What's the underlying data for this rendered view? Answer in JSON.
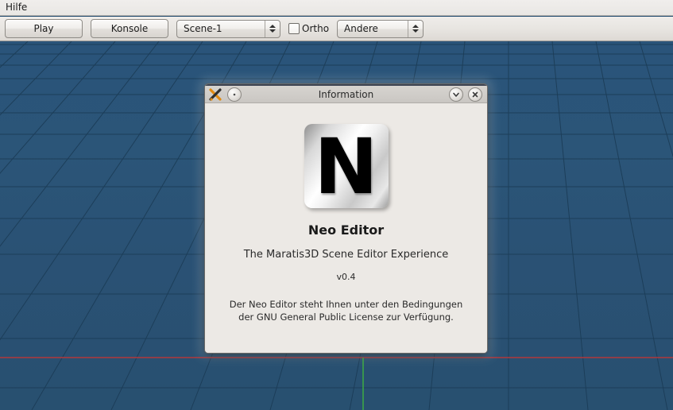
{
  "menubar": {
    "items": [
      {
        "label": "Hilfe",
        "name": "menu-item-hilfe"
      }
    ]
  },
  "toolbar": {
    "play_label": "Play",
    "console_label": "Konsole",
    "scene_combo": {
      "value": "Scene-1",
      "icon": "spinner-arrows-icon"
    },
    "ortho_checkbox": {
      "label": "Ortho",
      "checked": false
    },
    "other_combo": {
      "value": "Andere",
      "icon": "spinner-arrows-icon"
    }
  },
  "viewport": {
    "background_color": "#2a5375",
    "grid_line_color": "#1b3b56",
    "x_axis_color": "#b1383c",
    "z_axis_color": "#3fb23f"
  },
  "dialog": {
    "title": "Information",
    "app_icon": "maratis-app-icon",
    "menu_button_icon": "window-menu-icon",
    "shade_button_icon": "chevron-down-icon",
    "close_button_icon": "close-icon",
    "logo": {
      "letter": "N",
      "name": "neo-editor-logo"
    },
    "app_name": "Neo Editor",
    "tagline": "The Maratis3D Scene Editor Experience",
    "version": "v0.4",
    "license_line1": "Der Neo Editor steht Ihnen unter den Bedingungen",
    "license_line2": "der GNU General Public License zur Verfügung."
  }
}
